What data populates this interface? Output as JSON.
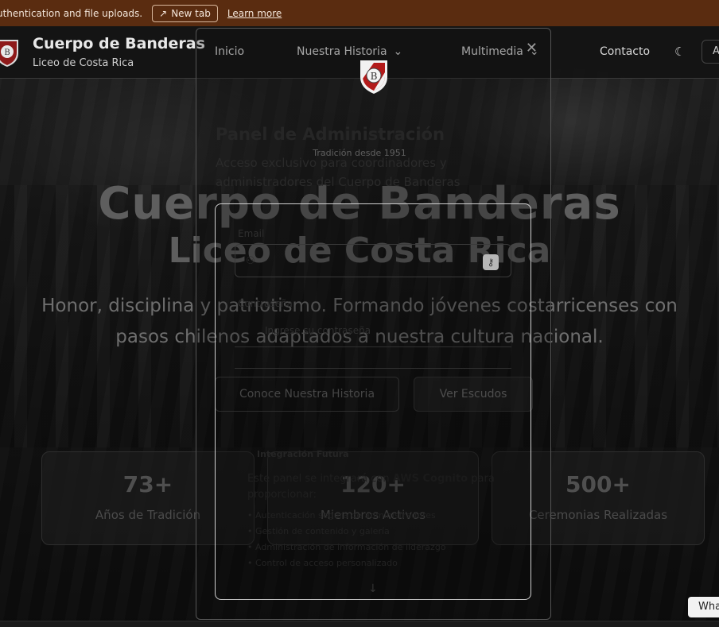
{
  "banner": {
    "text": "uthentication and file uploads.",
    "new_tab": "New tab",
    "learn_more": "Learn more"
  },
  "header": {
    "title": "Cuerpo de Banderas",
    "subtitle": "Liceo de Costa Rica",
    "nav": [
      "Inicio",
      "Nuestra Historia",
      "Multimedia",
      "Contacto"
    ],
    "lang": "A"
  },
  "hero": {
    "badge": "Tradición desde 1951",
    "title": "Cuerpo de Banderas",
    "subtitle": "Liceo de Costa Rica",
    "tagline": "Honor, disciplina y patriotismo. Formando jóvenes costarricenses con pasos chilenos adaptados a nuestra cultura nacional.",
    "btn_history": "Conoce Nuestra Historia",
    "btn_shields": "Ver Escudos"
  },
  "stats": [
    {
      "num": "73+",
      "label": "Años de Tradición"
    },
    {
      "num": "120+",
      "label": "Miembros Activos"
    },
    {
      "num": "500+",
      "label": "Ceremonias Realizadas"
    }
  ],
  "modal": {
    "title": "Panel de Administración",
    "description": "Acceso exclusivo para coordinadores y administradores del Cuerpo de Banderas",
    "email_label": "Email",
    "password_label": "Contraseña",
    "password_placeholder": "Ingrese su contraseña",
    "integration_title": "Integración Futura",
    "integration_text_pre": "Este panel se integrará con",
    "integration_strong": "AWS Cognito",
    "integration_text_post": "para proporcionar:",
    "features": [
      "• Autenticación segura de administradores",
      "• Gestión de contenido y galería",
      "• Administración de información de liderazgo",
      "• Control de acceso personalizado"
    ]
  },
  "float_button": "Wha"
}
